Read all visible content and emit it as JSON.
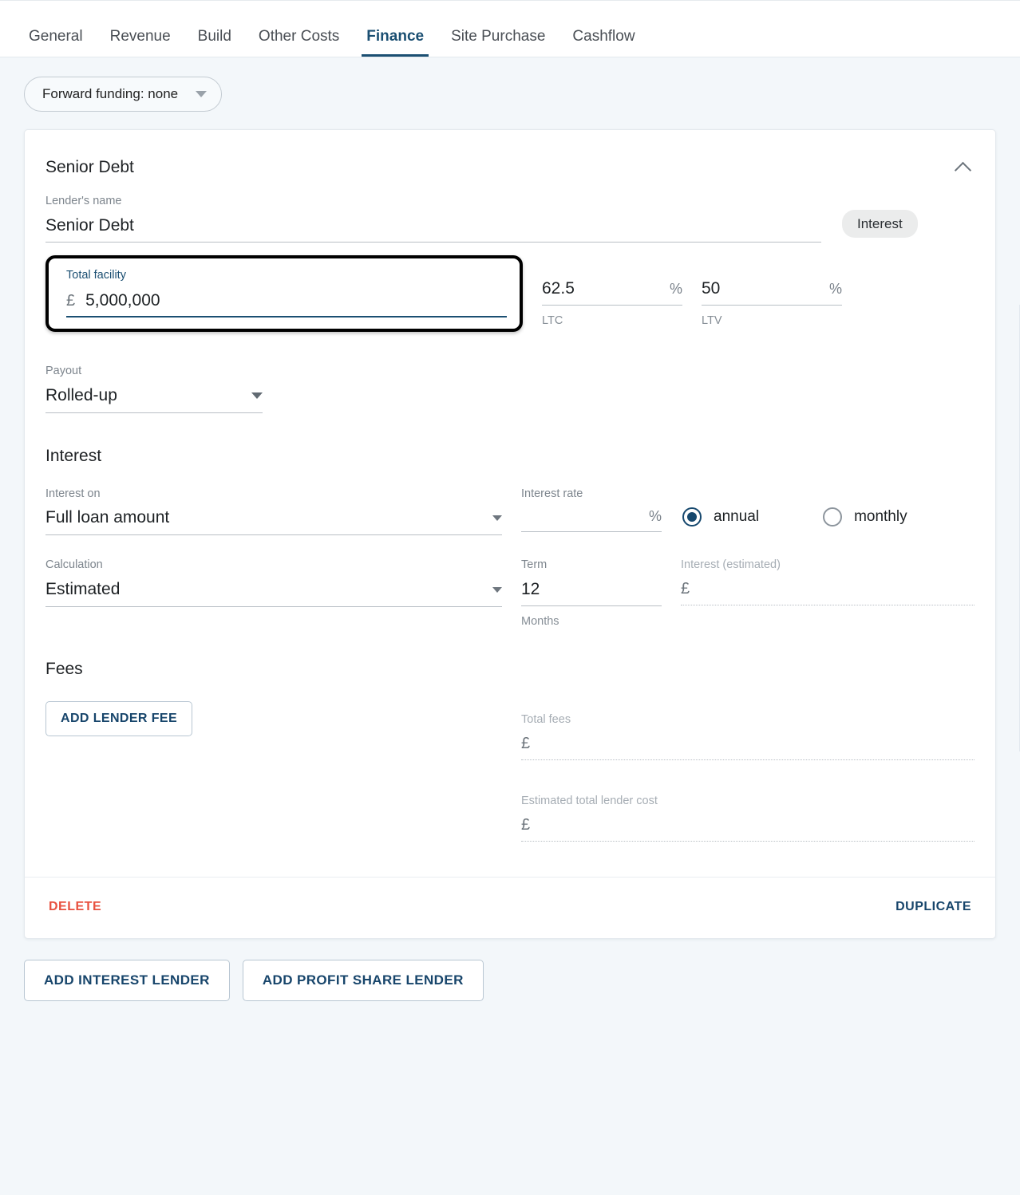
{
  "tabs": [
    {
      "label": "General",
      "active": false
    },
    {
      "label": "Revenue",
      "active": false
    },
    {
      "label": "Build",
      "active": false
    },
    {
      "label": "Other Costs",
      "active": false
    },
    {
      "label": "Finance",
      "active": true
    },
    {
      "label": "Site Purchase",
      "active": false
    },
    {
      "label": "Cashflow",
      "active": false
    }
  ],
  "forward_funding": {
    "label": "Forward funding: none"
  },
  "lender_card": {
    "title": "Senior Debt",
    "badge": "Interest",
    "lender_name": {
      "label": "Lender's name",
      "value": "Senior Debt"
    },
    "total_facility": {
      "label": "Total facility",
      "currency": "£",
      "value": "5,000,000",
      "focused": true
    },
    "ltc": {
      "value": "62.5",
      "suffix": "%",
      "hint": "LTC"
    },
    "ltv": {
      "value": "50",
      "suffix": "%",
      "hint": "LTV"
    },
    "payout": {
      "label": "Payout",
      "value": "Rolled-up"
    },
    "interest_section": {
      "heading": "Interest",
      "interest_on": {
        "label": "Interest on",
        "value": "Full loan amount"
      },
      "interest_rate": {
        "label": "Interest rate",
        "value": "",
        "suffix": "%"
      },
      "frequency": {
        "options": [
          {
            "label": "annual",
            "selected": true
          },
          {
            "label": "monthly",
            "selected": false
          }
        ]
      },
      "calculation": {
        "label": "Calculation",
        "value": "Estimated"
      },
      "term": {
        "label": "Term",
        "value": "12",
        "hint": "Months"
      },
      "interest_estimated": {
        "label": "Interest (estimated)",
        "currency": "£",
        "value": ""
      }
    },
    "fees_section": {
      "heading": "Fees",
      "add_fee_button": "ADD LENDER FEE",
      "total_fees": {
        "label": "Total fees",
        "currency": "£",
        "value": ""
      },
      "estimated_total_lender_cost": {
        "label": "Estimated total lender cost",
        "currency": "£",
        "value": ""
      }
    },
    "footer": {
      "delete": "DELETE",
      "duplicate": "DUPLICATE"
    }
  },
  "bottom_actions": {
    "add_interest_lender": "ADD INTEREST LENDER",
    "add_profit_share_lender": "ADD PROFIT SHARE LENDER"
  },
  "colors": {
    "accent": "#17456b",
    "danger": "#e8513f",
    "page_bg": "#f3f7fa",
    "focus_ring": "#000000"
  }
}
